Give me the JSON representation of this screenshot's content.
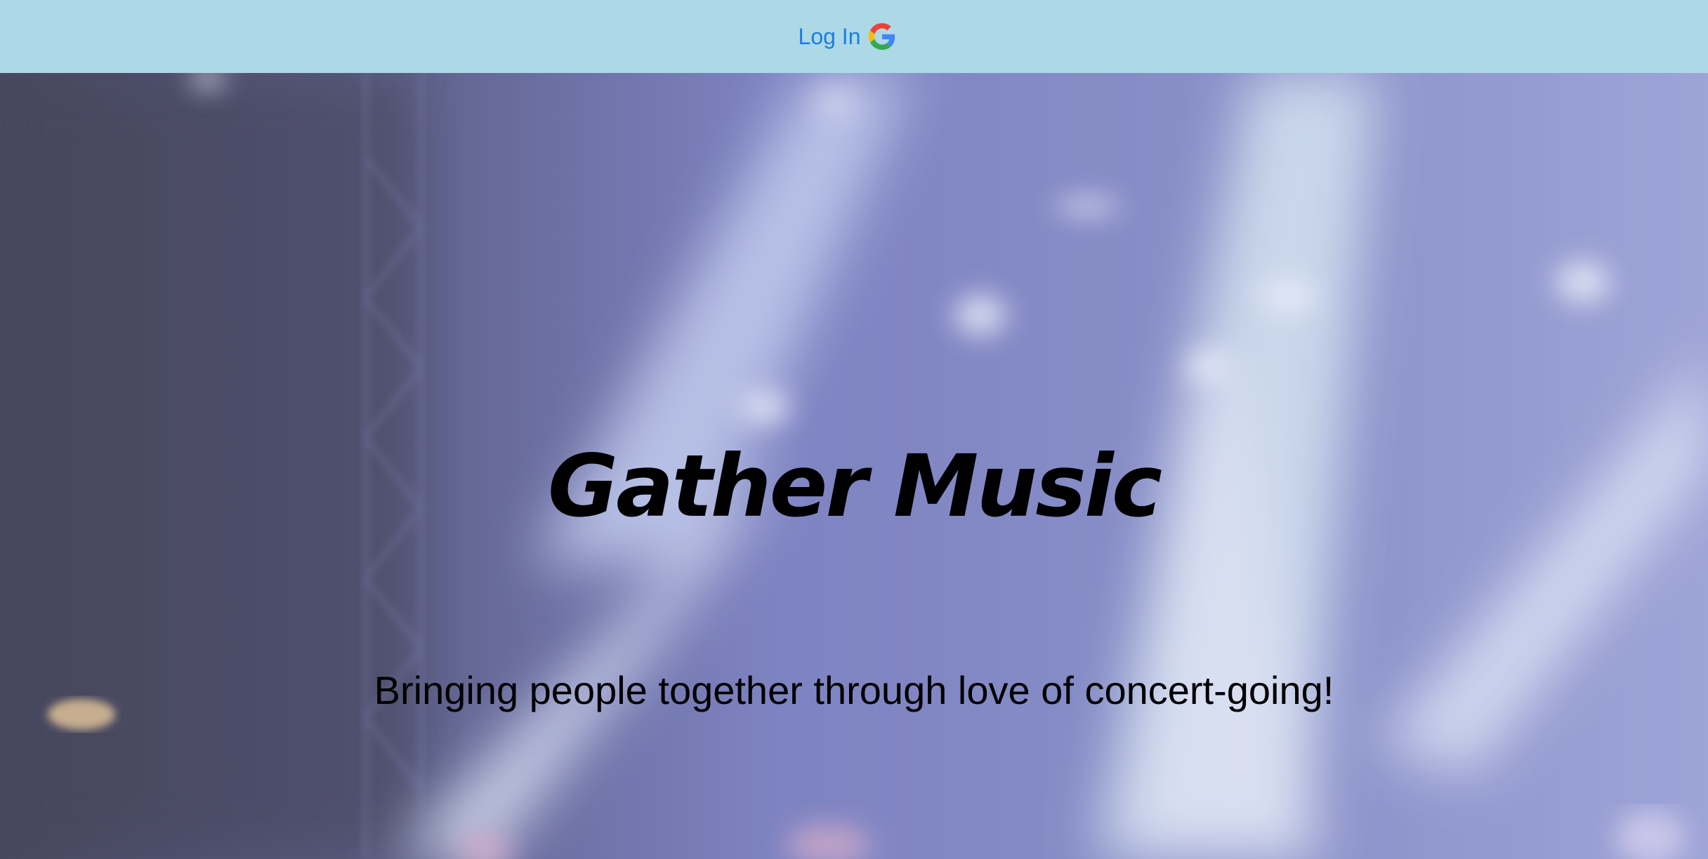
{
  "header": {
    "login_label": "Log In",
    "login_icon": "google-icon",
    "background_color": "#add8e6",
    "link_color": "#1a7fe0"
  },
  "hero": {
    "title": "Gather Music",
    "tagline": "Bringing people together through love of concert-going!",
    "background_image": "blurred concert stage with blue-violet spotlights",
    "text_color": "#000000"
  }
}
